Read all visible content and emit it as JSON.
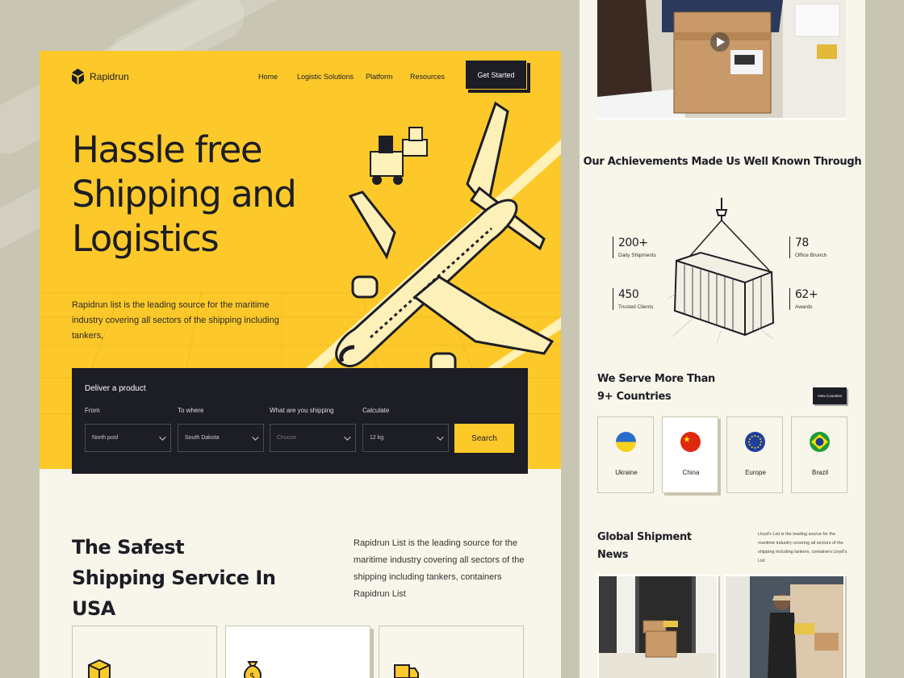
{
  "landing": {
    "nav": {
      "brand": "Rapidrun",
      "links": [
        "Home",
        "Logistic Solutions",
        "Platform",
        "Resources"
      ],
      "cta": "Get Started"
    },
    "hero": {
      "title": "Hassle free Shipping and Logistics",
      "description": "Rapidrun list is the leading source for the maritime industry covering all sectors of the shipping including tankers,"
    },
    "search": {
      "title": "Deliver a product",
      "fields": [
        {
          "label": "From",
          "value": "North pool"
        },
        {
          "label": "To where",
          "value": "South Dakota"
        },
        {
          "label": "What are you shipping",
          "value": "Choose"
        },
        {
          "label": "Calculate",
          "value": "12 kg"
        }
      ],
      "button": "Search"
    },
    "safest": {
      "title": "The Safest Shipping Service In USA",
      "description": "Rapidrun List is the leading source for the maritime industry covering all sectors of the shipping including tankers, containers Rapidrun List"
    }
  },
  "detail": {
    "achievements": {
      "title": "Our Achievements Made Us Well Known Through",
      "stats": [
        {
          "value": "200+",
          "label": "Daily Shipments"
        },
        {
          "value": "450",
          "label": "Trusted Clients"
        },
        {
          "value": "78",
          "label": "Office Brunch"
        },
        {
          "value": "62+",
          "label": "Awards"
        }
      ]
    },
    "countries": {
      "title": "We Serve More Than 9+ Countries",
      "button": "View Countries",
      "items": [
        {
          "name": "Ukraine",
          "icon": "ukraine-flag-icon"
        },
        {
          "name": "China",
          "icon": "china-flag-icon"
        },
        {
          "name": "Europe",
          "icon": "eu-flag-icon"
        },
        {
          "name": "Brazil",
          "icon": "brazil-flag-icon"
        }
      ]
    },
    "news": {
      "title": "Global Shipment News",
      "description": "Lloyd's List is the leading source for the maritime industry covering all sectors of the shipping including tankers, containers Lloyd's List"
    }
  },
  "colors": {
    "accent": "#fdc92a",
    "dark": "#1c1d25",
    "cream": "#f8f6ea",
    "backdrop": "#c9c5b3"
  }
}
